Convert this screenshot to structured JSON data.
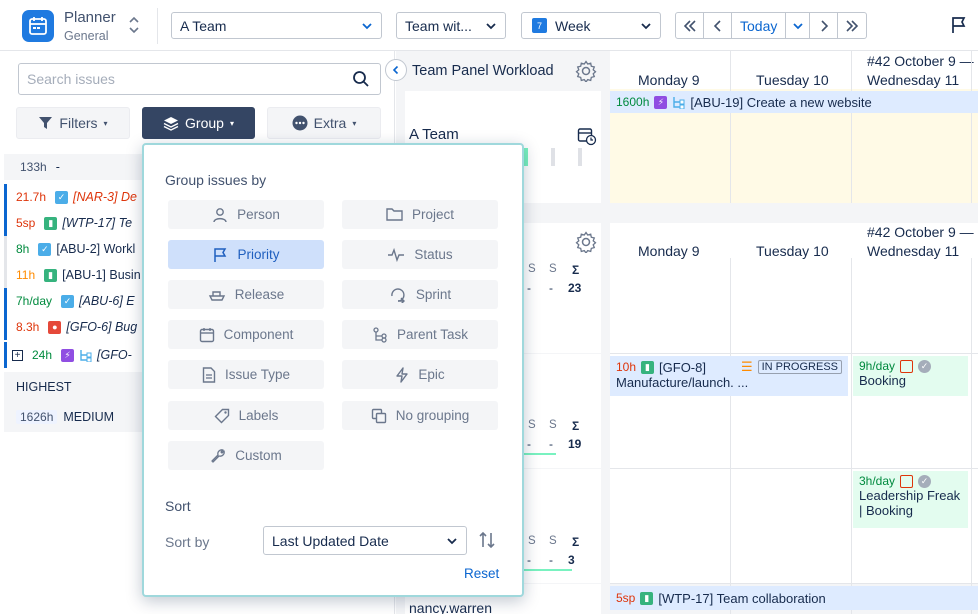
{
  "app": {
    "name": "Planner",
    "subtitle": "General"
  },
  "toolbar": {
    "team_select": "A Team",
    "view_select": "Team wit...",
    "period_select": "Week",
    "period_badge": "7",
    "today_label": "Today"
  },
  "search": {
    "placeholder": "Search issues"
  },
  "buttons": {
    "filters": "Filters",
    "group": "Group",
    "extra": "Extra"
  },
  "left_list": {
    "total": "133h",
    "total_suffix": "-",
    "rows": [
      {
        "hours": "21.7h",
        "key": "[NAR-3] De"
      },
      {
        "hours": "5sp",
        "key": "[WTP-17] Te"
      },
      {
        "hours": "8h",
        "key": "[ABU-2] Workl"
      },
      {
        "hours": "11h",
        "key": "[ABU-1] Busin"
      },
      {
        "hours": "7h/day",
        "key": "[ABU-6] E"
      },
      {
        "hours": "8.3h",
        "key": "[GFO-6] Bug"
      },
      {
        "hours": "24h",
        "key": "[GFO-"
      }
    ],
    "groups": [
      {
        "label": "HIGHEST"
      },
      {
        "hours": "1626h",
        "label": "MEDIUM"
      }
    ]
  },
  "panel": {
    "title": "Team Panel Workload",
    "team_name": "A Team",
    "user_name": "nancy.warren"
  },
  "calendar": {
    "week_header": "#42 October 9 —",
    "days": [
      "Monday 9",
      "Tuesday 10",
      "Wednesday 11"
    ]
  },
  "tasks": {
    "t1": {
      "hours": "1600h",
      "label": "[ABU-19] Create a new website"
    },
    "t2": {
      "hours": "10h",
      "key": "[GFO-8]",
      "label": "Manufacture/launch. ...",
      "status": "IN PROGRESS"
    },
    "t3": {
      "hours": "9h/day",
      "label": "Booking"
    },
    "t4": {
      "hours": "3h/day",
      "label1": "Leadership Freak",
      "label2": "| Booking"
    },
    "t5": {
      "hours": "5sp",
      "label": "[WTP-17] Team collaboration"
    }
  },
  "summaries": [
    {
      "s1": "S",
      "s2": "S",
      "sigma": "Σ",
      "d1": "-",
      "d2": "-",
      "total": "23"
    },
    {
      "s1": "S",
      "s2": "S",
      "sigma": "Σ",
      "d1": "-",
      "d2": "-",
      "total": "19"
    },
    {
      "s1": "S",
      "s2": "S",
      "sigma": "Σ",
      "d1": "-",
      "d2": "-",
      "total": "3"
    }
  ],
  "popup": {
    "title": "Group issues by",
    "options": [
      {
        "label": "Person",
        "icon": "person-icon"
      },
      {
        "label": "Project",
        "icon": "folder-icon"
      },
      {
        "label": "Priority",
        "icon": "flag-icon"
      },
      {
        "label": "Status",
        "icon": "pulse-icon"
      },
      {
        "label": "Release",
        "icon": "ship-icon"
      },
      {
        "label": "Sprint",
        "icon": "sprint-icon"
      },
      {
        "label": "Component",
        "icon": "calendar-icon"
      },
      {
        "label": "Parent Task",
        "icon": "tree-icon"
      },
      {
        "label": "Issue Type",
        "icon": "document-icon"
      },
      {
        "label": "Epic",
        "icon": "bolt-icon"
      },
      {
        "label": "Labels",
        "icon": "tag-icon"
      },
      {
        "label": "No grouping",
        "icon": "copy-icon"
      },
      {
        "label": "Custom",
        "icon": "wrench-icon"
      }
    ],
    "sort_title": "Sort",
    "sort_by_label": "Sort by",
    "sort_value": "Last Updated Date",
    "reset": "Reset"
  },
  "colors": {
    "accent": "#0b66d0",
    "brand": "#1f7ae0",
    "active_option": "#cfe0fb"
  }
}
